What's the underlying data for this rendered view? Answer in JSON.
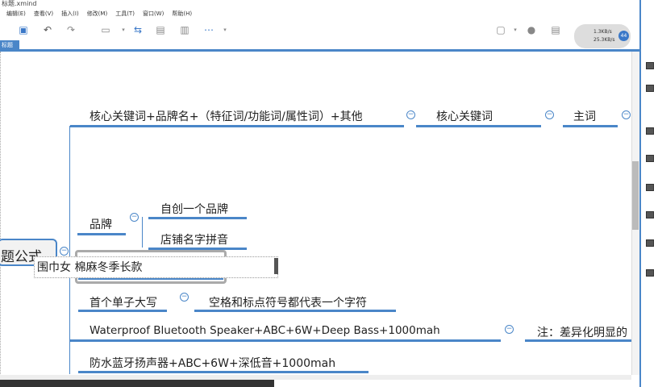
{
  "window": {
    "title": "标题.xmind"
  },
  "menu": [
    "编辑(E)",
    "查看(V)",
    "插入(I)",
    "修改(M)",
    "工具(T)",
    "窗口(W)",
    "帮助(H)"
  ],
  "toolbar": {
    "icons": [
      "save-icon",
      "undo-icon",
      "redo-icon",
      "topic-icon",
      "relationship-icon",
      "boundary-icon",
      "summary-icon",
      "more-icon",
      "presentation-icon",
      "idea-icon",
      "outline-icon"
    ]
  },
  "network": {
    "up": "1.3KB/s",
    "down": "25.3KB/s",
    "percent": "44"
  },
  "tab": {
    "label": "标题"
  },
  "mindmap": {
    "root": "题公式",
    "formula": "核心关键词+品牌名+（特征词/功能词/属性词）+其他",
    "core": "核心关键词",
    "main": "主词",
    "brand": "品牌",
    "brand_children": [
      "自创一个品牌",
      "店铺名字拼音"
    ],
    "editing": "围巾女  棉麻冬季长款",
    "capital": "首个单子大写",
    "capital_note": "空格和标点符号都代表一个字符",
    "english": "Waterproof  Bluetooth   Speaker+ABC+6W+Deep  Bass+1000mah",
    "english_note": "注：差异化明显的",
    "chinese": "防水蓝牙扬声器+ABC+6W+深低音+1000mah"
  },
  "colors": {
    "accent": "#4a86c8"
  }
}
